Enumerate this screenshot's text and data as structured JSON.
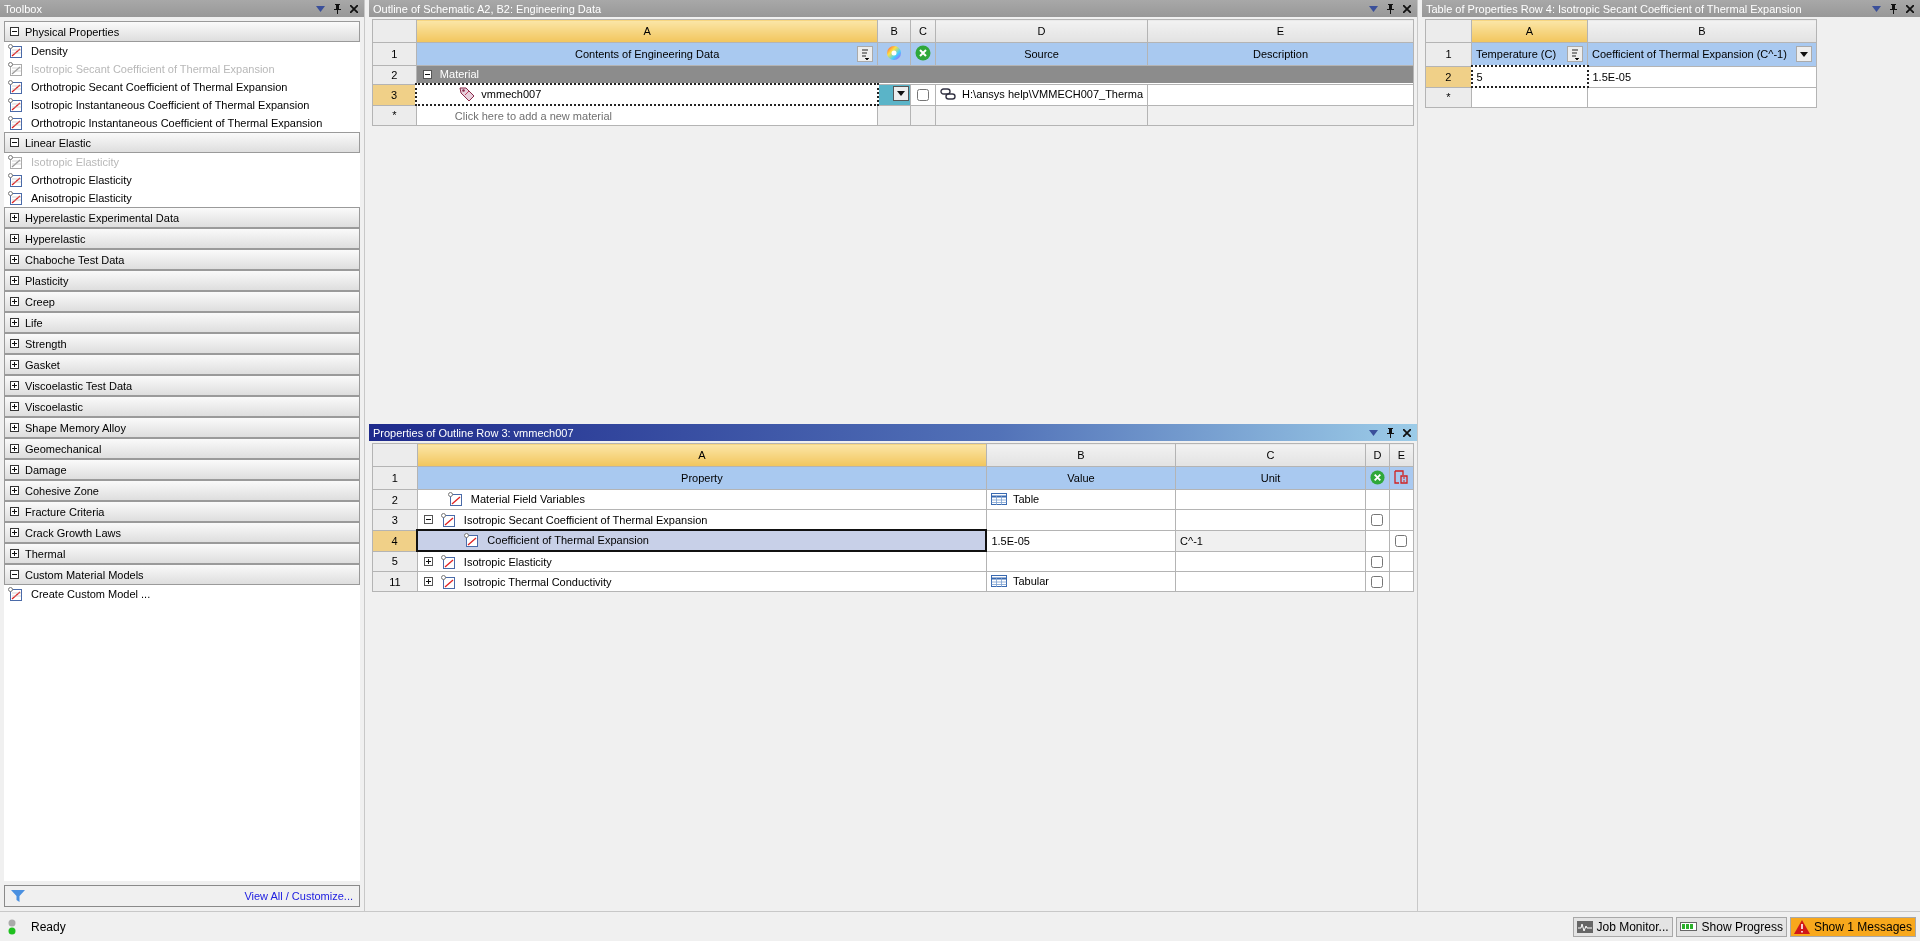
{
  "toolbox": {
    "title": "Toolbox",
    "active": false,
    "categories": [
      {
        "label": "Physical Properties",
        "expanded": true,
        "items": [
          {
            "label": "Density",
            "disabled": false
          },
          {
            "label": "Isotropic Secant Coefficient of Thermal Expansion",
            "disabled": true
          },
          {
            "label": "Orthotropic Secant Coefficient of Thermal Expansion",
            "disabled": false
          },
          {
            "label": "Isotropic Instantaneous Coefficient of Thermal Expansion",
            "disabled": false
          },
          {
            "label": "Orthotropic Instantaneous Coefficient of Thermal Expansion",
            "disabled": false
          }
        ]
      },
      {
        "label": "Linear Elastic",
        "expanded": true,
        "items": [
          {
            "label": "Isotropic Elasticity",
            "disabled": true
          },
          {
            "label": "Orthotropic Elasticity",
            "disabled": false
          },
          {
            "label": "Anisotropic Elasticity",
            "disabled": false
          }
        ]
      },
      {
        "label": "Hyperelastic Experimental Data",
        "expanded": false
      },
      {
        "label": "Hyperelastic",
        "expanded": false
      },
      {
        "label": "Chaboche Test Data",
        "expanded": false
      },
      {
        "label": "Plasticity",
        "expanded": false
      },
      {
        "label": "Creep",
        "expanded": false
      },
      {
        "label": "Life",
        "expanded": false
      },
      {
        "label": "Strength",
        "expanded": false
      },
      {
        "label": "Gasket",
        "expanded": false
      },
      {
        "label": "Viscoelastic Test Data",
        "expanded": false
      },
      {
        "label": "Viscoelastic",
        "expanded": false
      },
      {
        "label": "Shape Memory Alloy",
        "expanded": false
      },
      {
        "label": "Geomechanical",
        "expanded": false
      },
      {
        "label": "Damage",
        "expanded": false
      },
      {
        "label": "Cohesive Zone",
        "expanded": false
      },
      {
        "label": "Fracture Criteria",
        "expanded": false
      },
      {
        "label": "Crack Growth Laws",
        "expanded": false
      },
      {
        "label": "Thermal",
        "expanded": false
      },
      {
        "label": "Custom Material Models",
        "expanded": true,
        "items": [
          {
            "label": "Create Custom Model ...",
            "disabled": false
          }
        ]
      }
    ],
    "footer_link": "View All / Customize..."
  },
  "outline": {
    "title": "Outline of Schematic A2, B2: Engineering Data",
    "active": false,
    "columns": [
      "A",
      "B",
      "C",
      "D",
      "E"
    ],
    "header": {
      "row": "1",
      "contents": "Contents of Engineering Data",
      "source": "Source",
      "description": "Description"
    },
    "rows": [
      {
        "row": "2",
        "kind": "group",
        "label": "Material",
        "expanded": true
      },
      {
        "row": "3",
        "kind": "material",
        "label": "vmmech007",
        "selected": true,
        "checked": false,
        "source": "H:\\ansys help\\VMMECH007_Therma"
      },
      {
        "row": "*",
        "kind": "new",
        "hint": "Click here to add a new material"
      }
    ]
  },
  "properties": {
    "title": "Properties of Outline Row 3: vmmech007",
    "active": true,
    "columns": [
      "A",
      "B",
      "C",
      "D",
      "E"
    ],
    "header": {
      "row": "1",
      "property": "Property",
      "value": "Value",
      "unit": "Unit"
    },
    "rows": [
      {
        "row": "2",
        "kind": "plain",
        "label": "Material Field Variables",
        "value": "Table",
        "value_icon": true,
        "selected": false
      },
      {
        "row": "3",
        "kind": "group",
        "label": "Isotropic Secant Coefficient of Thermal Expansion",
        "expanded": true,
        "checked": false,
        "selected": false
      },
      {
        "row": "4",
        "kind": "child",
        "label": "Coefficient of Thermal Expansion",
        "value": "1.5E-05",
        "value_icon": false,
        "unit": "C^-1",
        "checked": false,
        "selected": true
      },
      {
        "row": "5",
        "kind": "group",
        "label": "Isotropic Elasticity",
        "expanded": false,
        "checked": false,
        "selected": false
      },
      {
        "row": "11",
        "kind": "group",
        "label": "Isotropic Thermal Conductivity",
        "expanded": false,
        "value": "Tabular",
        "value_icon": true,
        "checked": false,
        "selected": false
      }
    ]
  },
  "table": {
    "title": "Table of Properties Row 4: Isotropic Secant Coefficient of Thermal Expansion",
    "active": false,
    "columns": [
      "A",
      "B"
    ],
    "header": {
      "row": "1",
      "temperature": "Temperature (C)",
      "coefficient": "Coefficient of Thermal Expansion (C^-1)"
    },
    "rows": [
      {
        "row": "2",
        "cells": [
          "5",
          "1.5E-05"
        ],
        "selected": true
      },
      {
        "row": "*",
        "selected": false
      }
    ]
  },
  "status_bar": {
    "text": "Ready",
    "buttons": [
      {
        "label": "Job Monitor...",
        "kind": "monitor",
        "alert": false
      },
      {
        "label": "Show Progress",
        "kind": "progress",
        "alert": false
      },
      {
        "label": "Show 1 Messages",
        "kind": "messages",
        "alert": true
      }
    ]
  }
}
